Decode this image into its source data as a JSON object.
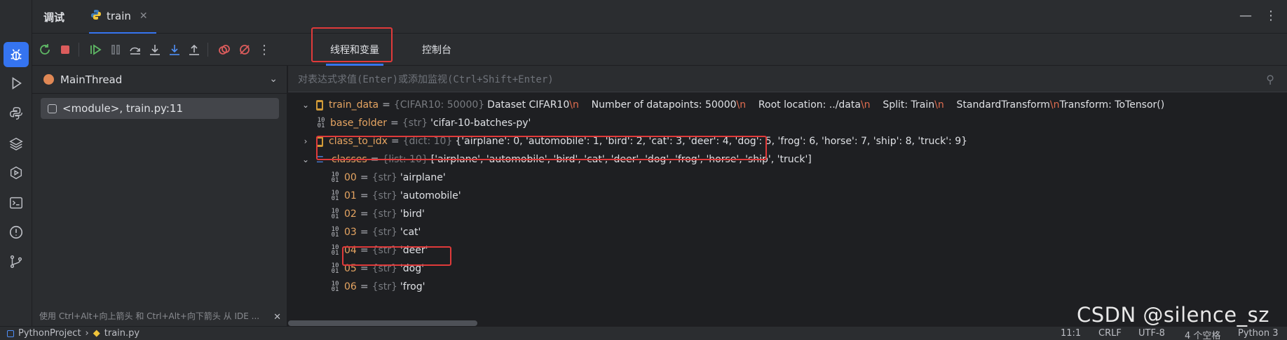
{
  "top_tabs": {
    "debug": "调试",
    "train": "train",
    "close": "✕",
    "more": "⋮",
    "minimize": "—"
  },
  "sub_tabs": {
    "threads": "线程和变量",
    "console": "控制台"
  },
  "frames": {
    "thread": "MainThread",
    "items": [
      {
        "label": "<module>, train.py:11"
      }
    ],
    "hint": "使用 Ctrl+Alt+向上箭头 和 Ctrl+Alt+向下箭头 从 IDE ..."
  },
  "eval_placeholder": "对表达式求值(Enter)或添加监视(Ctrl+Shift+Enter)",
  "variables": [
    {
      "name": "train_data",
      "type": "{CIFAR10: 50000}",
      "value_parts": [
        "Dataset CIFAR10",
        "\\n",
        "    Number of datapoints: 50000",
        "\\n",
        "    Root location: ../data",
        "\\n",
        "    Split: Train",
        "\\n",
        "    StandardTransform",
        "\\n",
        "Transform: ToTensor()"
      ]
    },
    {
      "name": "base_folder",
      "type": "{str}",
      "value": "'cifar-10-batches-py'"
    },
    {
      "name": "class_to_idx",
      "type": "{dict: 10}",
      "value": "{'airplane': 0, 'automobile': 1, 'bird': 2, 'cat': 3, 'deer': 4, 'dog': 5, 'frog': 6, 'horse': 7, 'ship': 8, 'truck': 9}"
    },
    {
      "name": "classes",
      "type": "{list: 10}",
      "value": "['airplane', 'automobile', 'bird', 'cat', 'deer', 'dog', 'frog', 'horse', 'ship', 'truck']"
    },
    {
      "name": "00",
      "type": "{str}",
      "value": "'airplane'"
    },
    {
      "name": "01",
      "type": "{str}",
      "value": "'automobile'"
    },
    {
      "name": "02",
      "type": "{str}",
      "value": "'bird'"
    },
    {
      "name": "03",
      "type": "{str}",
      "value": "'cat'"
    },
    {
      "name": "04",
      "type": "{str}",
      "value": "'deer'"
    },
    {
      "name": "05",
      "type": "{str}",
      "value": "'dog'"
    },
    {
      "name": "06",
      "type": "{str}",
      "value": "'frog'"
    }
  ],
  "status": {
    "project": "PythonProject",
    "file": "train.py",
    "position": "11:1",
    "line_sep": "CRLF",
    "encoding": "UTF-8",
    "indent": "4 个空格",
    "interpreter": "Python 3"
  },
  "watermark": "CSDN @silence_sz",
  "colors": {
    "accent": "#3574f0",
    "highlight": "#e03a3a",
    "var_name": "#e6a562",
    "type": "#787b80"
  }
}
